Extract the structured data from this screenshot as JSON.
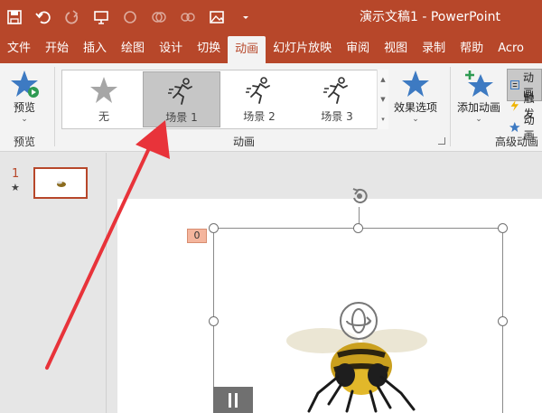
{
  "window": {
    "doc_title": "演示文稿1 - PowerPoint"
  },
  "tabs": [
    {
      "label": "文件",
      "active": false
    },
    {
      "label": "开始",
      "active": false
    },
    {
      "label": "插入",
      "active": false
    },
    {
      "label": "绘图",
      "active": false
    },
    {
      "label": "设计",
      "active": false
    },
    {
      "label": "切换",
      "active": false
    },
    {
      "label": "动画",
      "active": true
    },
    {
      "label": "幻灯片放映",
      "active": false
    },
    {
      "label": "审阅",
      "active": false
    },
    {
      "label": "视图",
      "active": false
    },
    {
      "label": "录制",
      "active": false
    },
    {
      "label": "帮助",
      "active": false
    },
    {
      "label": "Acro",
      "active": false
    }
  ],
  "ribbon": {
    "preview": {
      "label": "预览",
      "group_label": "预览"
    },
    "animation": {
      "group_label": "动画",
      "gallery": [
        {
          "label": "无",
          "icon": "star-gray-icon",
          "selected": false
        },
        {
          "label": "场景 1",
          "icon": "running-person-icon",
          "selected": true
        },
        {
          "label": "场景 2",
          "icon": "running-person-icon",
          "selected": false
        },
        {
          "label": "场景 3",
          "icon": "running-person-icon",
          "selected": false
        }
      ],
      "effect_options_label": "效果选项"
    },
    "advanced": {
      "group_label": "高级动画",
      "add_animation_label": "添加动画",
      "small_items": [
        "动画",
        "触发",
        "动画"
      ]
    }
  },
  "slides_pane": {
    "slide_number": "1",
    "star": "★"
  },
  "canvas": {
    "animation_tag": "0"
  },
  "colors": {
    "accent": "#b7472a",
    "selected": "#c6c6c6",
    "annotation_arrow": "#e8333a"
  }
}
